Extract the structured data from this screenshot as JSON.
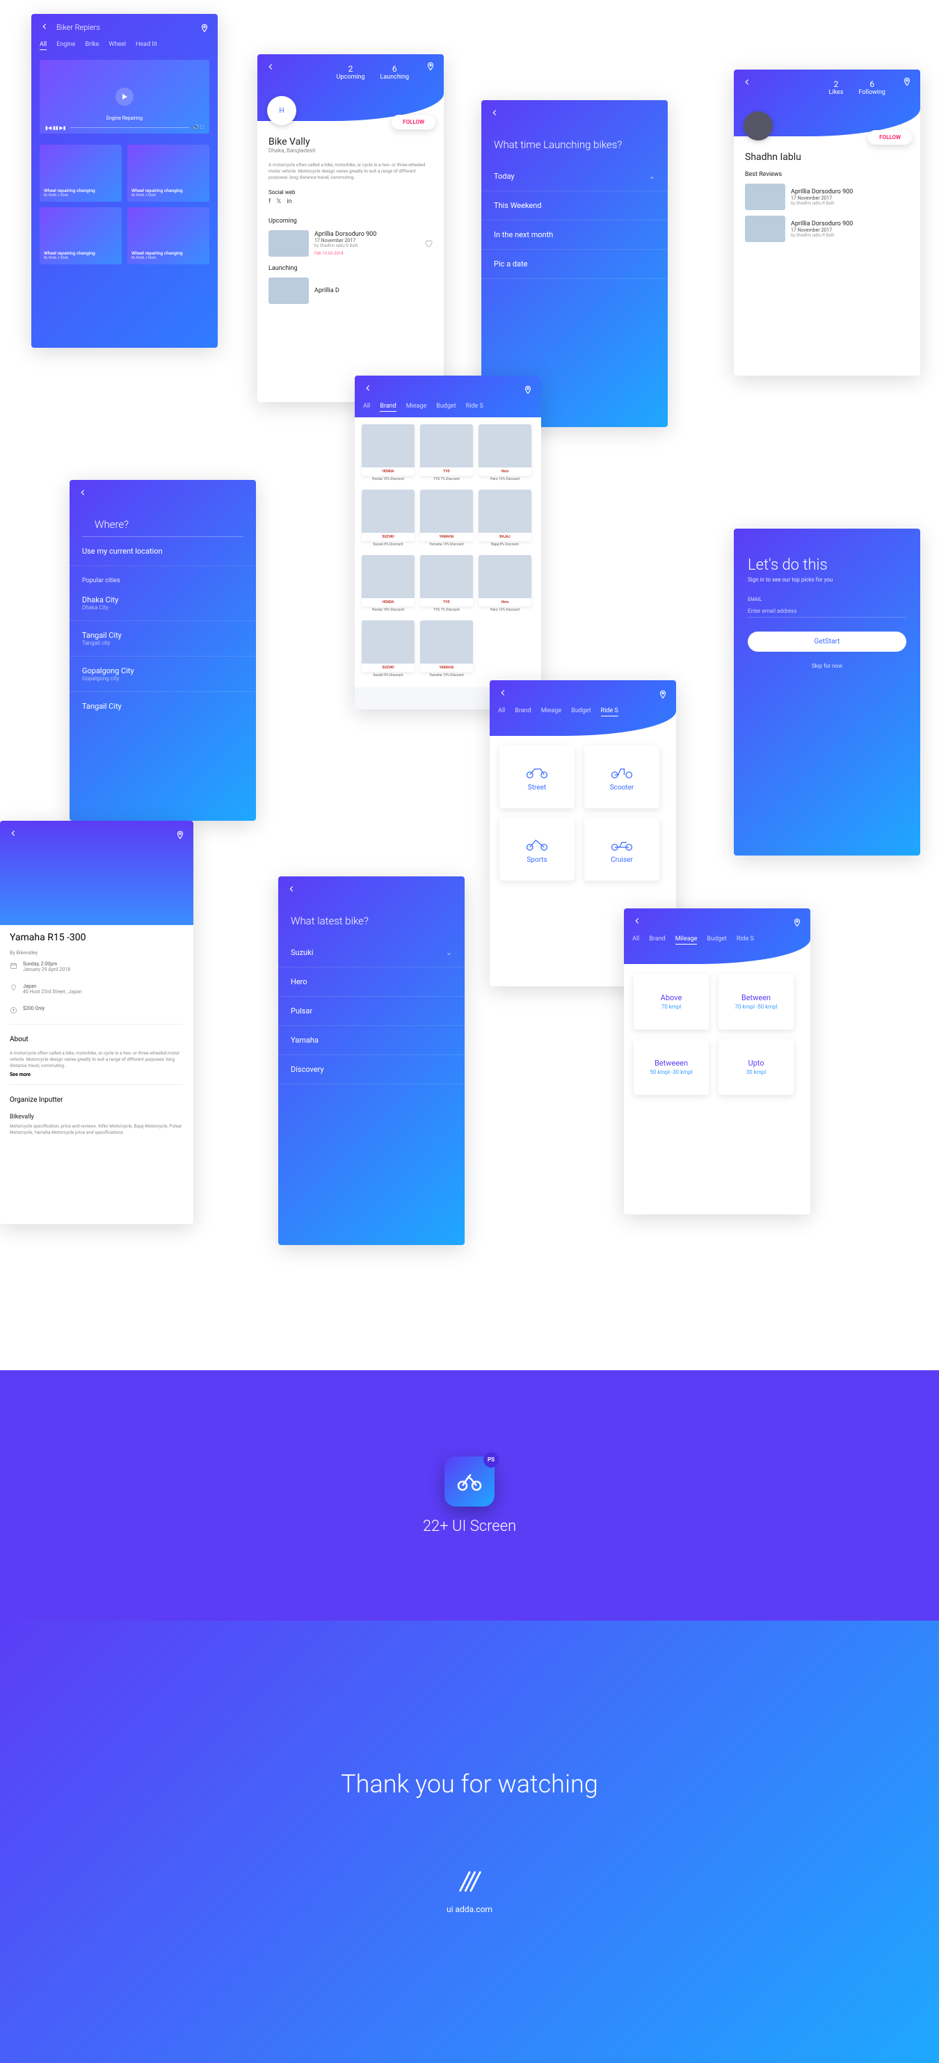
{
  "screen_repairs": {
    "title": "Biker Repiers",
    "tabs": [
      "All",
      "Engine",
      "Brike",
      "Wheel",
      "Head lit"
    ],
    "video_caption": "Engine Repairing",
    "thumb_title": "Wheel repairing changing",
    "thumb_sub": "By Robb J Stark"
  },
  "screen_profile": {
    "stats": [
      {
        "n": "2",
        "l": "Upcoming"
      },
      {
        "n": "6",
        "l": "Launching"
      }
    ],
    "follow": "FOLLOW",
    "name": "Bike Vally",
    "location": "Dhaka, Bangladesh",
    "desc": "A motorcycle often called a bike, motorbike, or cycle is a two- or three-wheeled motor vehicle. Motorcycle design varies greatly to suit a range of different purposes: long distance travel, commuting.",
    "social_label": "Social web",
    "upcoming_label": "Upcoming",
    "launching_label": "Launching",
    "item_title": "Aprillia Dorsoduro 900",
    "item_date": "17 November 2017",
    "item_by": "by Shadhin Iablu R Bath",
    "item_small": "Feb 12-02-2018",
    "item_partial": "Aprillia D"
  },
  "screen_time": {
    "question": "What time Launching bikes?",
    "options": [
      "Today",
      "This Weekend",
      "In the next month",
      "Pic a date"
    ]
  },
  "screen_brand": {
    "tabs": [
      "All",
      "Brand",
      "Mieage",
      "Budget",
      "Ride S"
    ],
    "active": "Brand",
    "cards_r1": [
      {
        "brand": "HONDA",
        "cap": "Honda 10% Discount"
      },
      {
        "brand": "TVS",
        "cap": "TVS 7% Discount"
      },
      {
        "brand": "Hero",
        "cap": "Hero 12% Discount"
      }
    ],
    "cards_r2": [
      {
        "brand": "SUZUKI",
        "cap": "Suzuki 8% Discount"
      },
      {
        "brand": "YAMAHA",
        "cap": "Yamaha 13% Discount"
      },
      {
        "brand": "BAJAJ",
        "cap": "Bajaj 8% Discount"
      }
    ]
  },
  "screen_where": {
    "question": "Where?",
    "use_loc": "Use my current location",
    "popular": "Popular cities",
    "cities": [
      {
        "n": "Dhaka City",
        "s": "Dhaka City"
      },
      {
        "n": "Tangail City",
        "s": "Tangail city"
      },
      {
        "n": "Gopalgong City",
        "s": "Gopalgong city"
      },
      {
        "n": "Tangail City",
        "s": ""
      }
    ]
  },
  "screen_detail": {
    "title": "Yamaha R15 -300",
    "by": "By Bikevalley",
    "time": "Sunday, 2.00pm",
    "time2": "January 29 April 2018",
    "place": "Japan",
    "place2": "40 Host 23rd Street , Japan",
    "price": "$200 Only",
    "about": "About",
    "about_desc": "A motorcycle often called a bike, motorbike, or cycle is a two- or three-wheeled motor vehicle. Motorcycle design varies greatly to suit a range of different purposes: long distance travel, commuting.",
    "see_more": "See more",
    "org_label": "Organize Inputter",
    "org_name": "Bikevally",
    "org_desc": "Motorcycle specification, price and reviews. Killer Motorcycle, Bajaj Motorcycle, Pulsar Motorcycle, Yamaha Motorcycle price and specifications."
  },
  "screen_latest": {
    "question": "What latest bike?",
    "options": [
      "Suzuki",
      "Hero",
      "Pulsar",
      "Yamaha",
      "Discovery"
    ]
  },
  "screen_user": {
    "stats": [
      {
        "n": "2",
        "l": "Likes"
      },
      {
        "n": "6",
        "l": "Following"
      }
    ],
    "name": "Shadhn Iablu",
    "best": "Best Reviews"
  },
  "screen_ride": {
    "tabs": [
      "All",
      "Brand",
      "Mieage",
      "Budget",
      "Ride S"
    ],
    "active": "Ride S",
    "cards": [
      "Street",
      "Scooter",
      "Sports",
      "Cruiser"
    ]
  },
  "screen_mileage": {
    "tabs": [
      "All",
      "Brand",
      "Mileage",
      "Budget",
      "Ride S"
    ],
    "active": "Mileage",
    "cards": [
      {
        "t": "Above",
        "s": "70 kmpl"
      },
      {
        "t": "Between",
        "s": "70 kmpl -50 kmpl"
      },
      {
        "t": "Betweeen",
        "s": "50 kmpl -30 kmpl"
      },
      {
        "t": "Upto",
        "s": "30 kmpl"
      }
    ]
  },
  "screen_start": {
    "hero": "Let's do this",
    "desc": "Sign in to see our top picks for you",
    "email_label": "EMAIL",
    "placeholder": "Enter email address",
    "btn": "GetStart",
    "skip": "Skip for now"
  },
  "footer": {
    "ps": "PS",
    "title": "22+ UI Screen",
    "thanks": "Thank you for watching",
    "url": "ui adda.com"
  }
}
